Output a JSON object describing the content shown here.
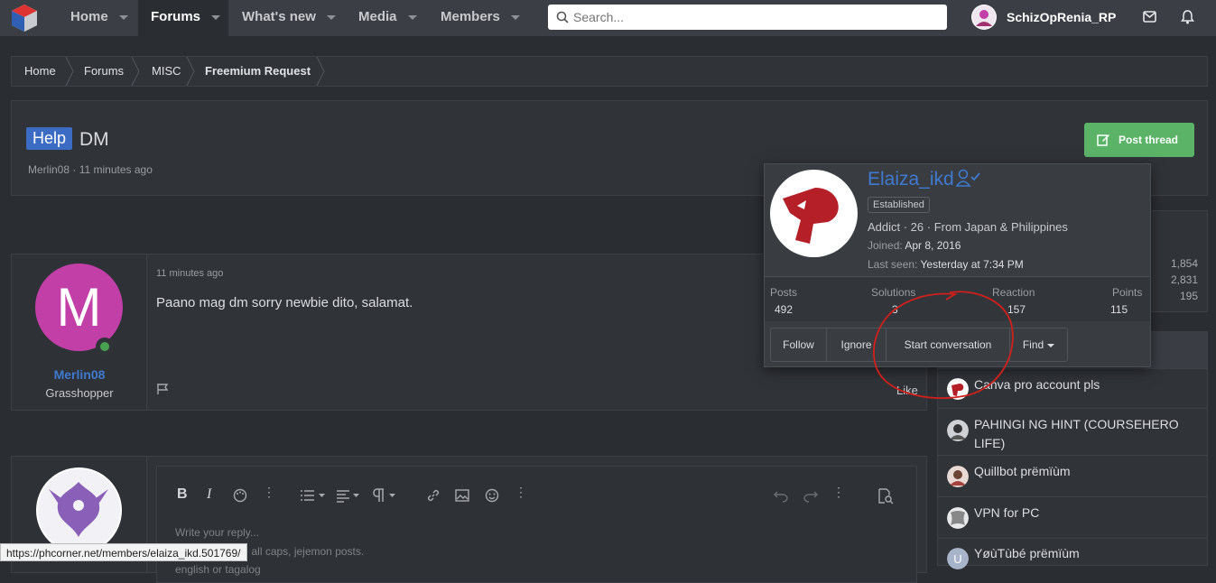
{
  "nav": {
    "items": [
      "Home",
      "Forums",
      "What's new",
      "Media",
      "Members"
    ],
    "search_placeholder": "Search...",
    "username": "SchizOpRenia_RP"
  },
  "breadcrumb": [
    "Home",
    "Forums",
    "MISC",
    "Freemium Request"
  ],
  "thread": {
    "prefix": "Help",
    "title": "DM",
    "author": "Merlin08",
    "time": "11 minutes ago",
    "post_thread_label": "Post thread"
  },
  "post": {
    "avatar_letter": "M",
    "author": "Merlin08",
    "role": "Grasshopper",
    "time": "11 minutes ago",
    "body": "Paano mag dm sorry newbie dito, salamat.",
    "like_label": "Like"
  },
  "reply": {
    "placeholder_lines": [
      "Write your reply...",
      "Avoid sms text, all caps, jejemon posts.",
      "english or tagalog"
    ]
  },
  "card": {
    "name": "Elaiza_ikd",
    "badge": "Established",
    "info": "Addict · 26 · From Japan & Philippines",
    "joined_label": "Joined:",
    "joined": "Apr 8, 2016",
    "seen_label": "Last seen:",
    "seen": "Yesterday at 7:34 PM",
    "stats": [
      {
        "label": "Posts",
        "value": "492"
      },
      {
        "label": "Solutions",
        "value": "3"
      },
      {
        "label": "Reaction",
        "value": "157"
      },
      {
        "label": "Points",
        "value": "115"
      }
    ],
    "buttons": [
      "Follow",
      "Ignore",
      "Start conversation",
      "Find"
    ]
  },
  "side_stats": [
    "1,854",
    "2,831",
    "195"
  ],
  "side_threads": [
    "Canva pro account pls",
    "PAHINGI NG HINT (COURSEHERO LIFE)",
    "Quillbot prëmïùm",
    "VPN for PC",
    "YøùTùbé prëmïùm"
  ],
  "status_url": "https://phcorner.net/members/elaiza_ikd.501769/",
  "colors": {
    "accent": "#3f7ad0",
    "post_button": "#5bb368",
    "annotation": "#d0201c"
  }
}
